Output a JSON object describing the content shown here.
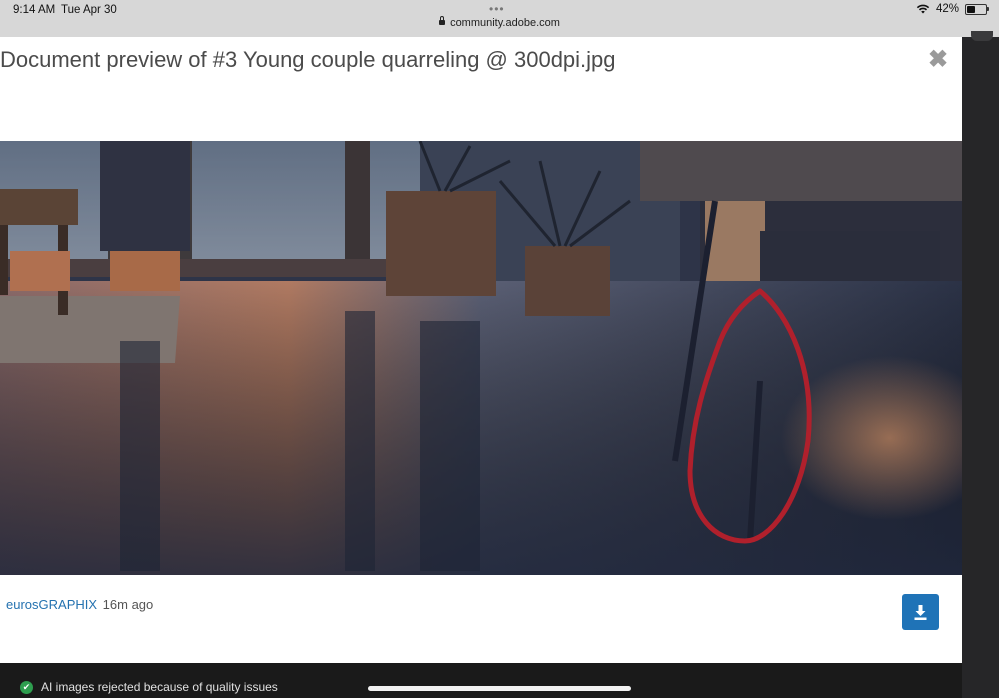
{
  "status_bar": {
    "time": "9:14 AM",
    "date": "Tue Apr 30",
    "dots": "•••",
    "url": "community.adobe.com",
    "battery": "42%",
    "battery_level": 0.42
  },
  "modal": {
    "title": "Document preview of #3 Young couple quarreling @ 300dpi.jpg",
    "close_symbol": "✖",
    "author": "eurosGRAPHIX",
    "time_ago": "16m ago",
    "download_icon": "download-icon"
  },
  "background": {
    "item_text": "AI images rejected because of quality issues",
    "check_icon": "checkmark-icon"
  },
  "colors": {
    "accent": "#1f73b7",
    "link": "#2472b0",
    "annotation": "#b0202c"
  }
}
